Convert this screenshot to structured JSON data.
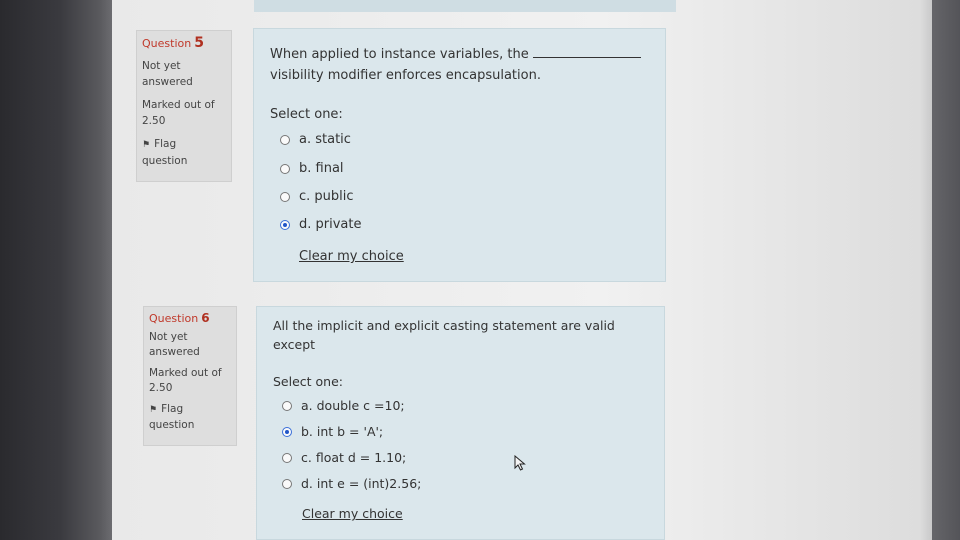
{
  "questions": [
    {
      "label": "Question",
      "number": "5",
      "state": [
        "Not yet",
        "answered"
      ],
      "mark": [
        "Marked out of",
        "2.50"
      ],
      "flag": [
        "Flag",
        "question"
      ],
      "text": [
        "When applied to instance variables, the",
        "visibility modifier enforces encapsulation."
      ],
      "prompt": "Select one:",
      "options": [
        {
          "label": "a. static",
          "selected": false
        },
        {
          "label": "b. final",
          "selected": false
        },
        {
          "label": "c. public",
          "selected": false
        },
        {
          "label": "d. private",
          "selected": true
        }
      ],
      "clear": "Clear my choice"
    },
    {
      "label": "Question",
      "number": "6",
      "state": [
        "Not yet",
        "answered"
      ],
      "mark": [
        "Marked out of",
        "2.50"
      ],
      "flag": [
        "Flag",
        "question"
      ],
      "text": [
        "All the implicit and explicit casting statement are valid",
        "except"
      ],
      "prompt": "Select one:",
      "options": [
        {
          "label": "a. double c =10;",
          "selected": false
        },
        {
          "label": "b. int b = 'A';",
          "selected": true
        },
        {
          "label": "c. float d = 1.10;",
          "selected": false
        },
        {
          "label": "d. int e = (int)2.56;",
          "selected": false
        }
      ],
      "clear": "Clear my choice"
    }
  ],
  "colors": {
    "accent": "#b03020",
    "panel": "#dbe7ec",
    "info": "#dedede",
    "radio_selected": "#2256c8"
  }
}
